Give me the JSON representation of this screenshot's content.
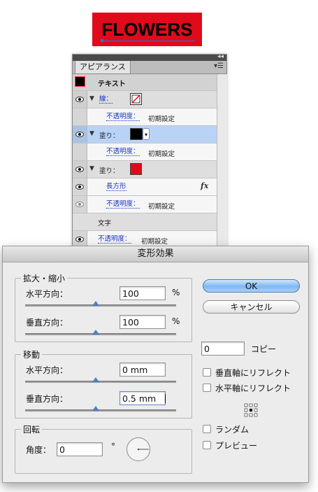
{
  "artwork": {
    "text": "FLOWERS",
    "fill": "#e10a1a",
    "text_color": "#000000"
  },
  "appearance_panel": {
    "tab_label": "アピアランス",
    "menu_icon": "panel-menu-icon",
    "rows": {
      "text_label": "テキスト",
      "stroke_label": "線：",
      "stroke_opacity_label": "不透明度：",
      "stroke_opacity_value": "初期設定",
      "fill1_label": "塗り：",
      "fill1_opacity_label": "不透明度：",
      "fill1_opacity_value": "初期設定",
      "fill2_label": "塗り：",
      "fill2_effect_label": "長方形",
      "fill2_fx": "fx",
      "fill2_opacity_label": "不透明度：",
      "fill2_opacity_value": "初期設定",
      "chars_label": "文字",
      "bottom_opacity_label": "不透明度：",
      "bottom_opacity_value": "初期設定"
    },
    "colors": {
      "fill1": "#000000",
      "fill2": "#e10a1a",
      "selected_row": "#b9d3f7"
    }
  },
  "dialog": {
    "title": "変形効果",
    "scale": {
      "group_title": "拡大・縮小",
      "h_label": "水平方向：",
      "h_value": "100",
      "h_unit": "%",
      "h_slider": 0.5,
      "v_label": "垂直方向：",
      "v_value": "100",
      "v_unit": "%",
      "v_slider": 0.5
    },
    "move": {
      "group_title": "移動",
      "h_label": "水平方向：",
      "h_value": "0 mm",
      "h_slider": 0.5,
      "v_label": "垂直方向：",
      "v_value": "0.5 mm",
      "v_slider": 0.5
    },
    "rotate": {
      "group_title": "回転",
      "angle_label": "角度：",
      "angle_value": "0",
      "angle_unit": "°"
    },
    "ok_label": "OK",
    "cancel_label": "キャンセル",
    "copies_value": "0",
    "copies_label": "コピー",
    "reflect_x_label": "垂直軸にリフレクト",
    "reflect_y_label": "水平軸にリフレクト",
    "random_label": "ランダム",
    "preview_label": "プレビュー"
  }
}
